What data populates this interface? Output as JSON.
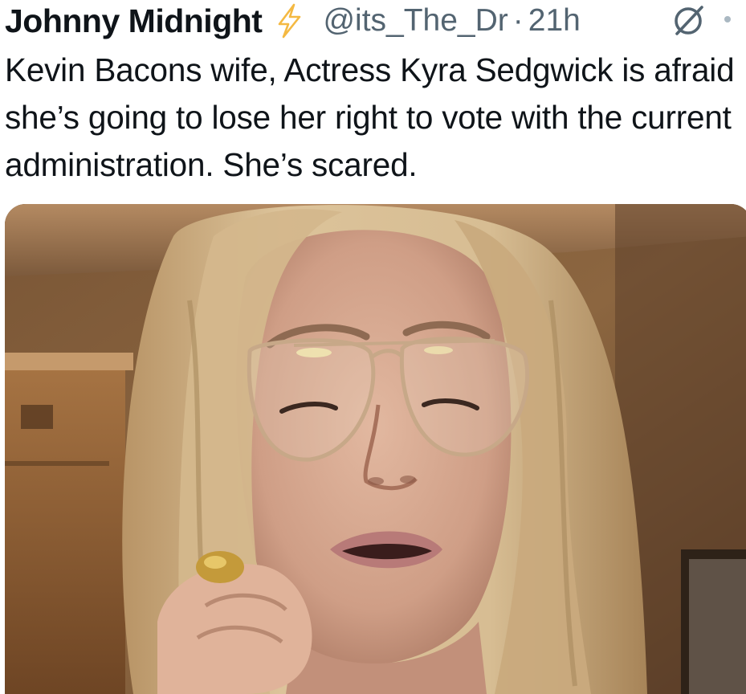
{
  "tweet": {
    "author_name": "Johnny Midnight",
    "badge_icon": "lightning-bolt-icon",
    "handle": "@its_The_Dr",
    "separator": "·",
    "time": "21h",
    "grok_icon": "grok-slash-circle-icon",
    "more_icon": "more-options-icon",
    "text": "Kevin Bacons wife, Actress Kyra Sedgwick is afraid she’s going to lose her right to vote with the current administration. She’s scared.",
    "media": {
      "type": "video-thumbnail"
    }
  },
  "colors": {
    "text_primary": "#0f1419",
    "text_secondary": "#536471",
    "bolt": "#f4b942"
  }
}
